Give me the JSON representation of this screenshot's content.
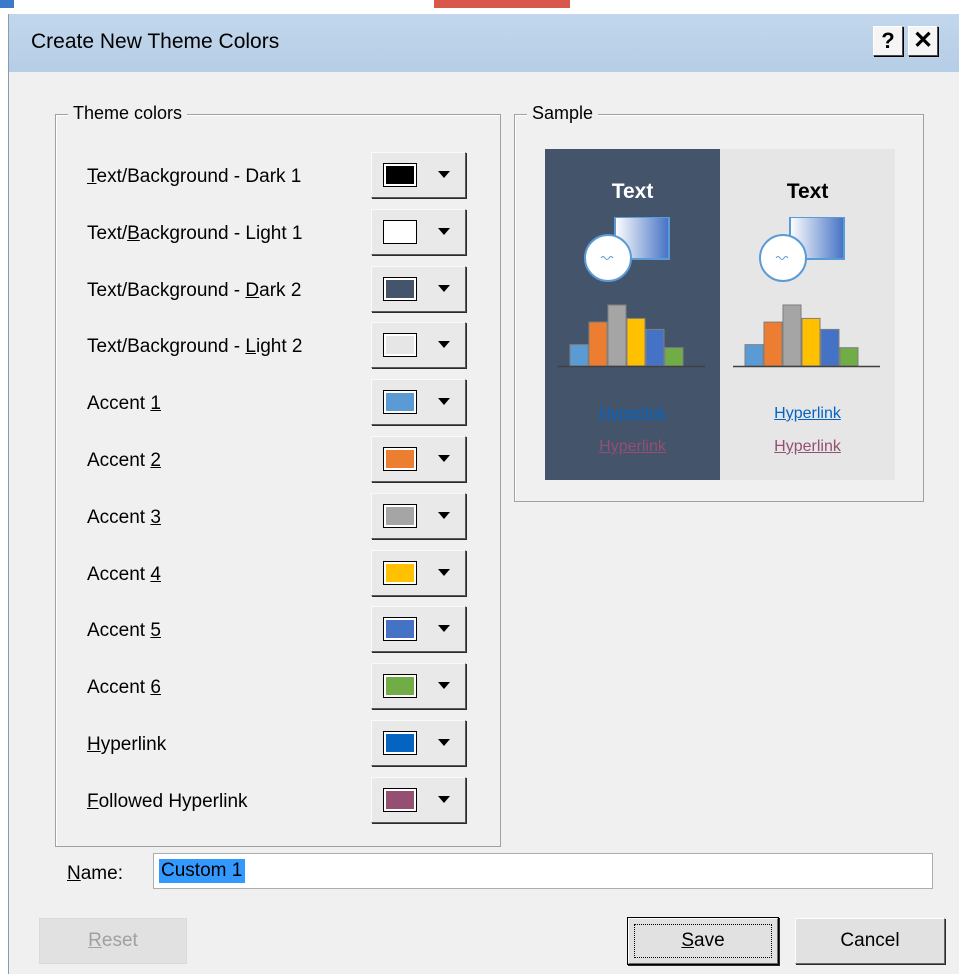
{
  "dialog": {
    "title": "Create New Theme Colors",
    "help_label": "?",
    "close_label": "✕"
  },
  "theme_colors": {
    "legend": "Theme colors",
    "rows": [
      {
        "pre": "",
        "key": "T",
        "post": "ext/Background - Dark 1",
        "color": "#000000"
      },
      {
        "pre": "Text/",
        "key": "B",
        "post": "ackground - Light 1",
        "color": "#ffffff"
      },
      {
        "pre": "Text/Background - ",
        "key": "D",
        "post": "ark 2",
        "color": "#44546a"
      },
      {
        "pre": "Text/Background - ",
        "key": "L",
        "post": "ight 2",
        "color": "#e7e6e6"
      },
      {
        "pre": "Accent ",
        "key": "1",
        "post": "",
        "color": "#5b9bd5"
      },
      {
        "pre": "Accent ",
        "key": "2",
        "post": "",
        "color": "#ed7d31"
      },
      {
        "pre": "Accent ",
        "key": "3",
        "post": "",
        "color": "#a5a5a5"
      },
      {
        "pre": "Accent ",
        "key": "4",
        "post": "",
        "color": "#ffc000"
      },
      {
        "pre": "Accent ",
        "key": "5",
        "post": "",
        "color": "#4472c4"
      },
      {
        "pre": "Accent ",
        "key": "6",
        "post": "",
        "color": "#70ad47"
      },
      {
        "pre": "",
        "key": "H",
        "post": "yperlink",
        "color": "#0563c1"
      },
      {
        "pre": "",
        "key": "F",
        "post": "ollowed Hyperlink",
        "color": "#954f72"
      }
    ]
  },
  "sample": {
    "legend": "Sample",
    "text": "Text",
    "hyperlink": "Hyperlink",
    "followed_hyperlink": "Hyperlink",
    "bar_levels": [
      0.35,
      0.72,
      1.0,
      0.78,
      0.6,
      0.3
    ]
  },
  "name": {
    "pre": "",
    "key": "N",
    "post": "ame:",
    "value": "Custom 1"
  },
  "buttons": {
    "reset": {
      "pre": "",
      "key": "R",
      "post": "eset"
    },
    "save": {
      "pre": "",
      "key": "S",
      "post": "ave"
    },
    "cancel": "Cancel"
  }
}
